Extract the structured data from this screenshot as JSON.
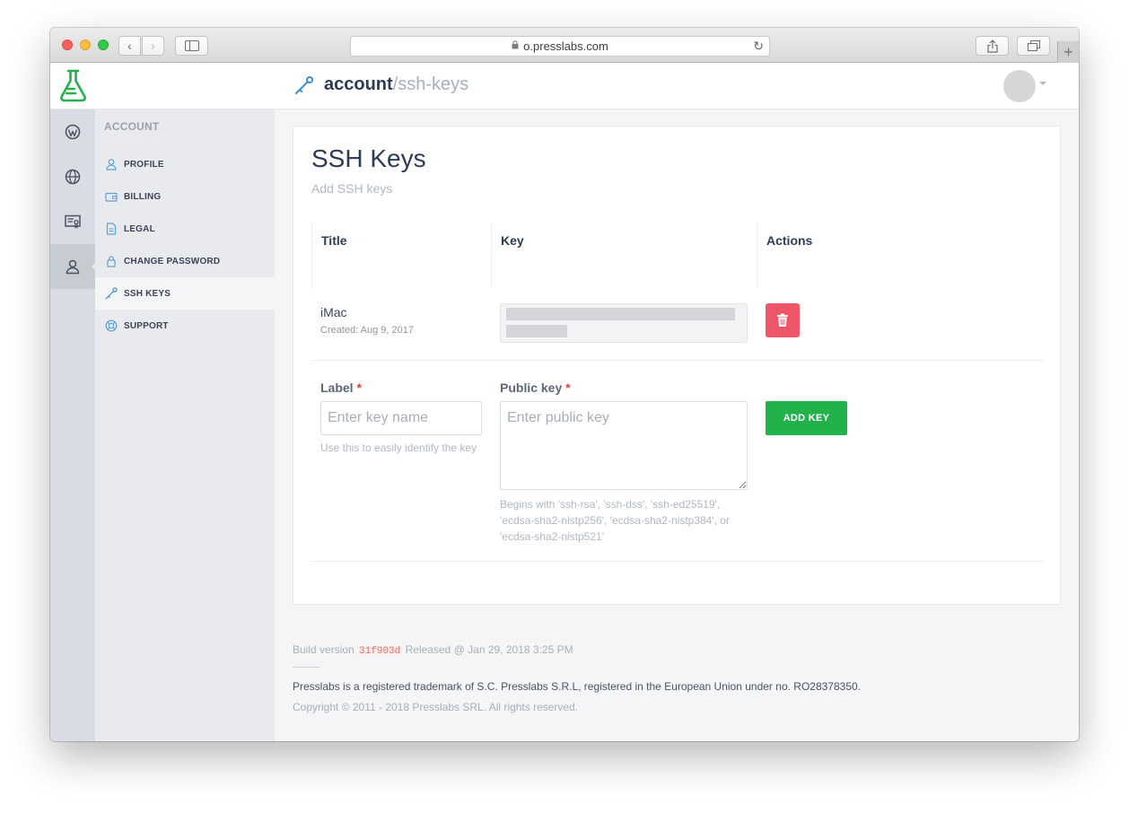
{
  "browser": {
    "url": "o.presslabs.com",
    "nav_back_glyph": "‹",
    "nav_fwd_glyph": "›",
    "new_tab_glyph": "+",
    "reload_glyph": "↻"
  },
  "header": {
    "title_main": "account",
    "title_sub": "/ssh-keys",
    "brand_color": "#22b24c"
  },
  "rail": {
    "items": [
      {
        "icon": "wordpress-icon"
      },
      {
        "icon": "globe-icon"
      },
      {
        "icon": "certificate-icon"
      },
      {
        "icon": "user-icon",
        "active": true
      }
    ]
  },
  "subnav": {
    "heading": "ACCOUNT",
    "items": [
      {
        "label": "PROFILE",
        "icon": "user-icon"
      },
      {
        "label": "BILLING",
        "icon": "wallet-icon"
      },
      {
        "label": "LEGAL",
        "icon": "document-icon"
      },
      {
        "label": "CHANGE PASSWORD",
        "icon": "lock-icon"
      },
      {
        "label": "SSH KEYS",
        "icon": "key-icon",
        "active": true
      },
      {
        "label": "SUPPORT",
        "icon": "lifebuoy-icon"
      }
    ]
  },
  "main": {
    "title": "SSH Keys",
    "subtitle": "Add SSH keys",
    "table": {
      "columns": [
        "Title",
        "Key",
        "Actions"
      ],
      "rows": [
        {
          "name": "iMac",
          "created": "Created: Aug 9, 2017"
        }
      ]
    },
    "form": {
      "label_label": "Label",
      "label_placeholder": "Enter key name",
      "label_hint": "Use this to easily identify the key",
      "pubkey_label": "Public key",
      "pubkey_placeholder": "Enter public key",
      "pubkey_hint": "Begins with 'ssh-rsa', 'ssh-dss', 'ssh-ed25519', 'ecdsa-sha2-nistp256', 'ecdsa-sha2-nistp384', or 'ecdsa-sha2-nistp521'",
      "required_mark": "*",
      "add_button": "ADD KEY"
    }
  },
  "footer": {
    "build_prefix": "Build version",
    "build_hash": "31f903d",
    "build_released": "Released @ Jan 29, 2018 3:25 PM",
    "trademark": "Presslabs is a registered trademark of S.C. Presslabs S.R.L, registered in the European Union under no. RO28378350.",
    "copyright": "Copyright © 2011 - 2018 Presslabs SRL. All rights reserved."
  },
  "colors": {
    "accent_green": "#22b24c",
    "danger_red": "#f0566a",
    "link_blue": "#5aa3d6",
    "text_dark": "#2e3b55"
  }
}
